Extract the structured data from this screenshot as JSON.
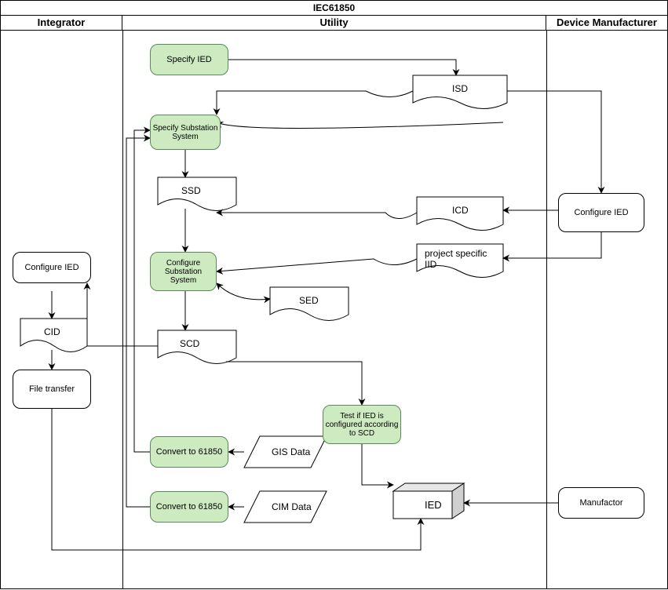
{
  "frame": {
    "title": "IEC61850"
  },
  "lanes": {
    "integrator": "Integrator",
    "utility": "Utility",
    "manufacturer": "Device Manufacturer"
  },
  "nodes": {
    "spec_ied": "Specify IED",
    "spec_sub": "Specify Substation System",
    "conf_sub": "Configure Substation System",
    "test_ied": "Test if IED is configured according to SCD",
    "conv1": "Convert to 61850",
    "conv2": "Convert to 61850",
    "int_conf": "Configure IED",
    "int_transfer": "File transfer",
    "dev_conf": "Configure IED",
    "dev_manu": "Manufactor",
    "isd": "ISD",
    "ssd": "SSD",
    "icd": "ICD",
    "iid": "project specific IID",
    "sed": "SED",
    "scd": "SCD",
    "cid": "CID",
    "gis": "GIS Data",
    "cim": "CIM Data",
    "ied_cube": "IED"
  }
}
